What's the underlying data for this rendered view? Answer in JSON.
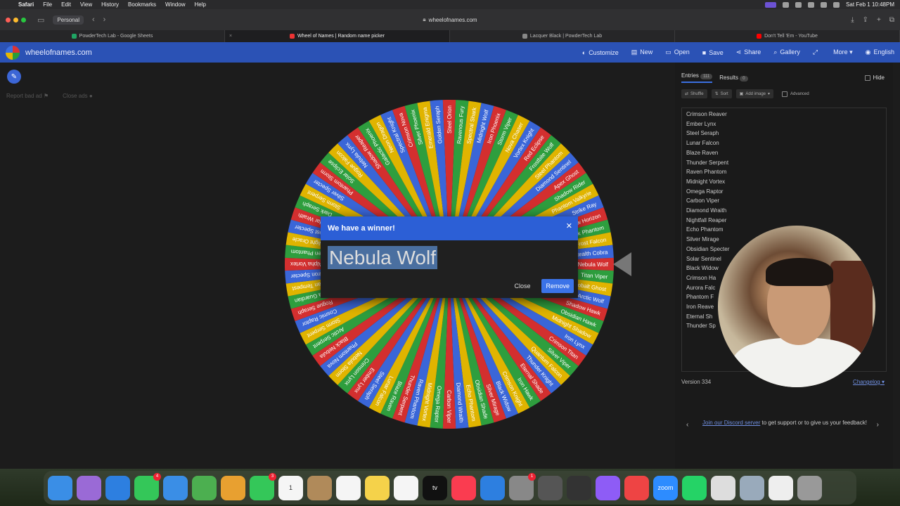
{
  "menubar": {
    "app": "Safari",
    "items": [
      "File",
      "Edit",
      "View",
      "History",
      "Bookmarks",
      "Window",
      "Help"
    ],
    "clock": "Sat Feb 1  10:48PM"
  },
  "browser": {
    "profile": "Personal",
    "url": "wheelofnames.com",
    "tabs": [
      {
        "label": "PowderTech Lab - Google Sheets",
        "color": "#1fa463"
      },
      {
        "label": "Wheel of Names | Random name picker",
        "color": "#e33"
      },
      {
        "label": "Lacquer Black | PowderTech Lab",
        "color": "#888"
      },
      {
        "label": "Don't Tell 'Em - YouTube",
        "color": "#f00"
      }
    ]
  },
  "app": {
    "site_name": "wheelofnames.com",
    "menu": [
      {
        "icon": "palette-icon",
        "glyph": "◐",
        "label": "Customize"
      },
      {
        "icon": "new-file-icon",
        "glyph": "▤",
        "label": "New"
      },
      {
        "icon": "folder-icon",
        "glyph": "▭",
        "label": "Open"
      },
      {
        "icon": "save-icon",
        "glyph": "■",
        "label": "Save"
      },
      {
        "icon": "share-icon",
        "glyph": "⋖",
        "label": "Share"
      },
      {
        "icon": "search-icon",
        "glyph": "⌕",
        "label": "Gallery"
      },
      {
        "icon": "fullscreen-icon",
        "glyph": "⤢",
        "label": ""
      },
      {
        "icon": "chevron-down-icon",
        "glyph": "",
        "label": "More ▾"
      },
      {
        "icon": "globe-icon",
        "glyph": "◉",
        "label": "English"
      }
    ],
    "report_ad": "Report bad ad",
    "close_ads": "Close ads"
  },
  "dialog": {
    "title": "We have a winner!",
    "winner": "Nebula Wolf",
    "close_label": "Close",
    "remove_label": "Remove"
  },
  "sidebar": {
    "entries_tab": "Entries",
    "entries_count": "111",
    "results_tab": "Results",
    "results_count": "0",
    "hide_label": "Hide",
    "shuffle": "Shuffle",
    "sort": "Sort",
    "add_image": "Add image",
    "advanced": "Advanced",
    "entries": [
      "Crimson Reaver",
      "Ember Lynx",
      "Steel Seraph",
      "Lunar Falcon",
      "Blaze Raven",
      "Thunder Serpent",
      "Raven Phantom",
      "Midnight Vortex",
      "Omega Raptor",
      "Carbon Viper",
      "Diamond Wraith",
      "Nightfall Reaper",
      "Echo Phantom",
      "Silver Mirage",
      "Obsidian Specter",
      "Solar Sentinel",
      "Black Widow",
      "Crimson Ha",
      "Aurora Falc",
      "Phantom F",
      "Iron Reave",
      "Eternal Sh",
      "Thunder Sp"
    ],
    "version": "Version 334",
    "changelog": "Changelog",
    "discord_link": "Join our Discord server",
    "discord_text": " to get support or to give us your feedback!"
  },
  "wheel": {
    "colors": [
      "#d32f2f",
      "#2e9e3e",
      "#e0b400",
      "#3a66d8"
    ],
    "labels": [
      "Nebula Wolf",
      "Titan Viper",
      "Cobalt Ghost",
      "Arctic Wolf",
      "Shadow Hawk",
      "Obsidian Hawk",
      "Midnight Shadow",
      "Iron Lynx",
      "Crimson Titan",
      "Silver Viper",
      "Quantum Falcon",
      "Thunder Knight",
      "Eternal Shade",
      "Iron Hawk",
      "Crimson Knight",
      "Black Widow",
      "Silver Mirage",
      "Obsidian Shade",
      "Echo Phantom",
      "Diamond Wraith",
      "Carbon Viper",
      "Omega Raptor",
      "Midnight Vortex",
      "Raven Phantom",
      "Thunder Serpent",
      "Blaze Raven",
      "Lunar Falcon",
      "Steel Seraph",
      "Ember Lynx",
      "Crimson Lynx",
      "Nebula Storm",
      "Phantom Nova",
      "Black Nebula",
      "Arctic Serpent",
      "Storm Serpent",
      "Cosmic Raptor",
      "Rogue Seraph",
      "Omega Guardian",
      "Titan Tempest",
      "Iron Specter",
      "Alpha Vortex",
      "Raven Phantom",
      "Night Oracle",
      "Ghost Specter",
      "Solar Wraith",
      "Dark Seraph",
      "Storm Serpent",
      "Silver Specter",
      "Phantom Storm",
      "Solar Eclipse",
      "Rogue Falcon",
      "Nebula Lynx",
      "Shadow Reaper",
      "Galactic Phoenix",
      "Neon Dragon",
      "Spectral Knight",
      "Crimson Nova",
      "Silver Phoenix",
      "Emerald Enigma",
      "Golden Seraph",
      "Steel Orion",
      "Ravenous Fury",
      "Spectral Shark",
      "Midnight Wolf",
      "Iron Phoenix",
      "Storm Viper",
      "Nova Chaser",
      "Vortex Knight",
      "Red Eclipse",
      "Frostbite Wolf",
      "Steel Phantom",
      "Diamond Sentinel",
      "Apex Ghost",
      "Shadow Rider",
      "Phantom Valkyrie",
      "Strike Ray",
      "Shadow Horizon",
      "Black Phantom",
      "Frost Falcon",
      "Stealth Cobra"
    ]
  },
  "dock": [
    {
      "name": "finder-icon",
      "color": "#3a8ee6",
      "label": ""
    },
    {
      "name": "launchpad-icon",
      "color": "#9a6ad6",
      "label": ""
    },
    {
      "name": "safari-icon",
      "color": "#2d7fe0",
      "label": ""
    },
    {
      "name": "messages-icon",
      "color": "#34c759",
      "label": "",
      "badge": "4"
    },
    {
      "name": "mail-icon",
      "color": "#3a8ee6",
      "label": ""
    },
    {
      "name": "maps-icon",
      "color": "#4caf50",
      "label": ""
    },
    {
      "name": "photos-icon",
      "color": "#e8a030",
      "label": ""
    },
    {
      "name": "facetime-icon",
      "color": "#34c759",
      "label": "",
      "badge": "3"
    },
    {
      "name": "calendar-icon",
      "color": "#f5f5f5",
      "label": "1"
    },
    {
      "name": "contacts-icon",
      "color": "#b08a5a",
      "label": ""
    },
    {
      "name": "reminders-icon",
      "color": "#f5f5f5",
      "label": ""
    },
    {
      "name": "notes-icon",
      "color": "#f5d24a",
      "label": ""
    },
    {
      "name": "freeform-icon",
      "color": "#f5f5f5",
      "label": ""
    },
    {
      "name": "tv-icon",
      "color": "#111",
      "label": "tv"
    },
    {
      "name": "music-icon",
      "color": "#fa3c50",
      "label": ""
    },
    {
      "name": "app-store-icon",
      "color": "#2d7fe0",
      "label": ""
    },
    {
      "name": "system-settings-icon",
      "color": "#888",
      "label": "",
      "badge": "1"
    },
    {
      "name": "iphone-mirroring-icon",
      "color": "#555",
      "label": ""
    },
    {
      "name": "calculator-icon",
      "color": "#333",
      "label": ""
    },
    {
      "name": "messenger-icon",
      "color": "#8e5cf6",
      "label": ""
    },
    {
      "name": "barcode-icon",
      "color": "#e44",
      "label": ""
    },
    {
      "name": "zoom-icon",
      "color": "#2d8cff",
      "label": "zoom"
    },
    {
      "name": "whatsapp-icon",
      "color": "#25d366",
      "label": ""
    },
    {
      "name": "chrome-icon",
      "color": "#ddd",
      "label": ""
    },
    {
      "name": "preview-icon",
      "color": "#9ab",
      "label": ""
    },
    {
      "name": "document-icon",
      "color": "#eee",
      "label": ""
    },
    {
      "name": "trash-icon",
      "color": "#999",
      "label": ""
    }
  ]
}
